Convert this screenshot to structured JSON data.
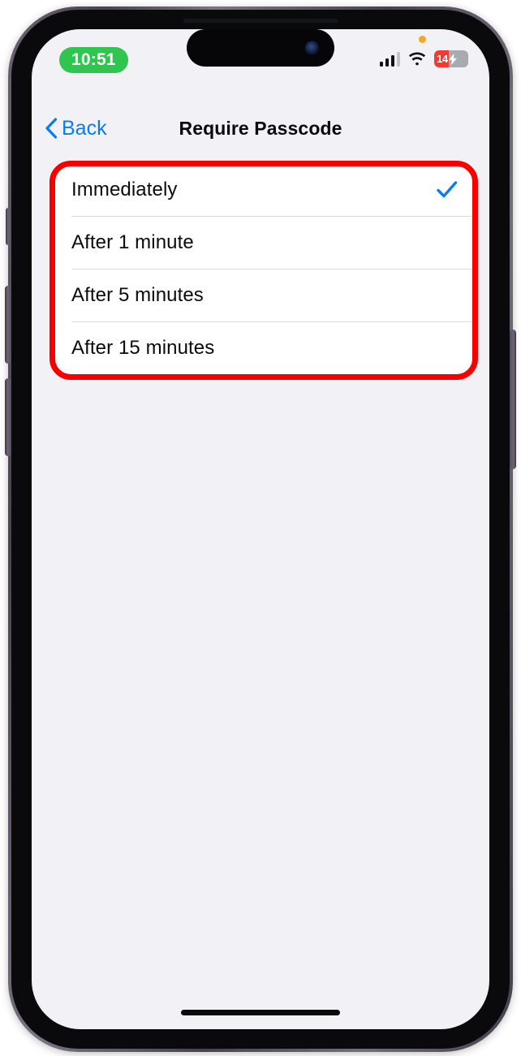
{
  "status_bar": {
    "time": "10:51",
    "time_pill_color": "#2fc54e",
    "mic_indicator_icon": "microphone-in-use-dot",
    "cellular_icon": "cellular-signal-icon",
    "cellular_bars_filled": 3,
    "cellular_bars_total": 4,
    "wifi_icon": "wifi-icon",
    "battery_level": "14",
    "battery_color": "#f03b33",
    "battery_charging_icon": "lightning-bolt-icon"
  },
  "nav_bar": {
    "back_label": "Back",
    "back_icon": "chevron-left-icon",
    "title": "Require Passcode",
    "accent_color": "#0a7cf0"
  },
  "options": {
    "items": [
      {
        "label": "Immediately",
        "selected": true,
        "check_icon": "checkmark-icon"
      },
      {
        "label": "After 1 minute",
        "selected": false,
        "check_icon": "checkmark-icon"
      },
      {
        "label": "After 5 minutes",
        "selected": false,
        "check_icon": "checkmark-icon"
      },
      {
        "label": "After 15 minutes",
        "selected": false,
        "check_icon": "checkmark-icon"
      }
    ],
    "checkmark_color": "#0a7cf0"
  },
  "annotation": {
    "highlight_color": "#f80000",
    "shape": "rounded-rectangle"
  },
  "device": {
    "dynamic_island_icon": "dynamic-island",
    "front_camera_icon": "front-camera-icon",
    "earpiece_icon": "earpiece-speaker",
    "home_indicator_icon": "home-indicator",
    "buttons": [
      "ring-silent-switch",
      "volume-up-button",
      "volume-down-button",
      "power-button"
    ]
  }
}
